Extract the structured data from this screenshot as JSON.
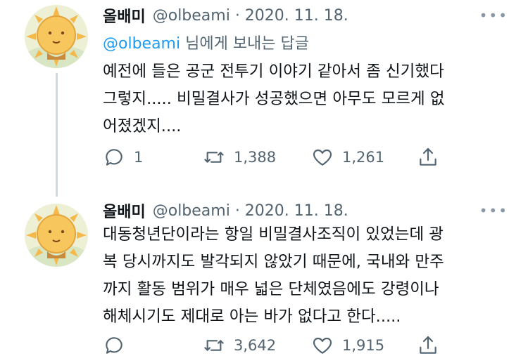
{
  "tweets": [
    {
      "display_name": "올배미",
      "handle_and_date": "@olbeami · 2020. 11. 18.",
      "replying_mention": "@olbeami",
      "replying_suffix": " 님에게 보내는 답글",
      "lines": [
        "예전에 들은 공군 전투기 이야기 같아서 좀 신기했다",
        "그렇지..... 비밀결사가 성공했으면 아무도 모르게 없",
        "어졌겠지...."
      ],
      "reply_count": "1",
      "retweet_count": "1,388",
      "like_count": "1,261"
    },
    {
      "display_name": "올배미",
      "handle_and_date": "@olbeami · 2020. 11. 18.",
      "lines": [
        "대동청년단이라는 항일 비밀결사조직이 있었는데 광",
        "복 당시까지도 발각되지 않았기 때문에, 국내와 만주",
        "까지 활동 범위가 매우 넓은 단체였음에도 강령이나",
        "해체시기도 제대로 아는 바가 없다고 한다....."
      ],
      "reply_count": "",
      "retweet_count": "3,642",
      "like_count": "1,915"
    }
  ],
  "colors": {
    "text_primary": "#0f1419",
    "text_secondary": "#536471",
    "link": "#1d9bf0",
    "thread_line": "#cfd9de"
  },
  "icons": {
    "more": "more-horizontal-icon",
    "reply": "speech-bubble-icon",
    "retweet": "retweet-arrows-icon",
    "like": "heart-outline-icon",
    "share": "share-upload-icon"
  }
}
